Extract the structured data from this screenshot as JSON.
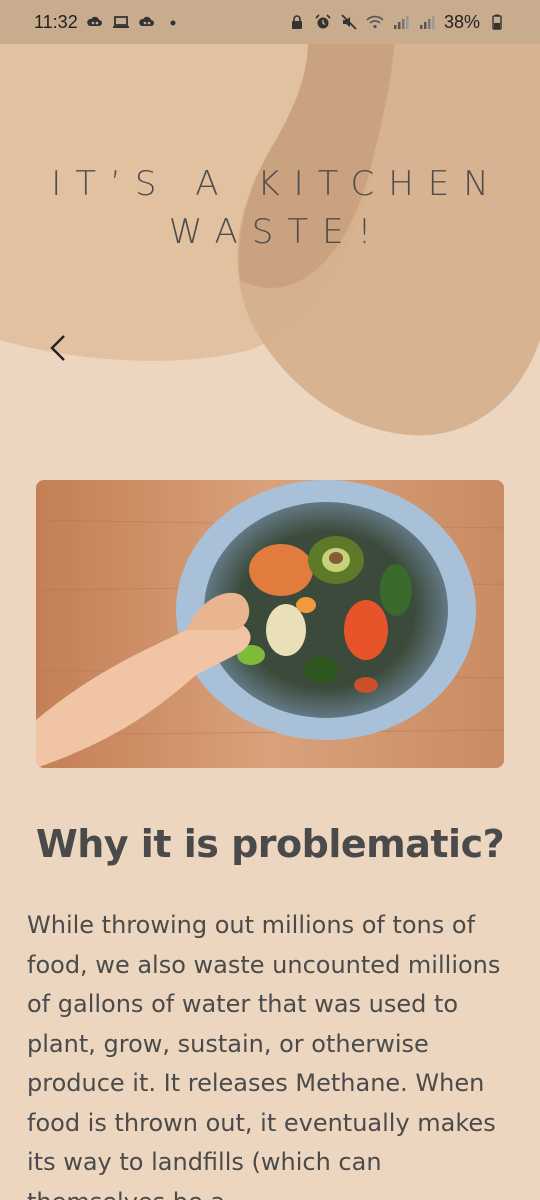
{
  "status_bar": {
    "time": "11:32",
    "battery": "38%",
    "left_icons": [
      "cloud-icon",
      "laptop-icon",
      "cloud-icon",
      "dot-icon"
    ],
    "right_icons": [
      "lock-icon",
      "alarm-icon",
      "mute-icon",
      "wifi-icon",
      "signal-icon",
      "signal-icon",
      "battery-icon"
    ]
  },
  "page": {
    "title": "IT’S A KITCHEN WASTE!",
    "back_icon": "chevron-left-icon",
    "photo_alt": "Hand dropping food scraps into a lined kitchen bin",
    "heading": "Why it is problematic?",
    "body": "While throwing out millions of tons of food, we also waste uncounted millions of gallons of water that was used to plant, grow, sustain, or otherwise produce it. It releases Methane. When food is thrown out, it eventually makes its way to landfills (which can themselves be a"
  },
  "colors": {
    "background": "#ecd6bf",
    "status_bar": "#c9ab8e",
    "blob_light": "#e2c1a1",
    "blob_dark": "#d2aa87",
    "text": "#4a4a4a"
  }
}
